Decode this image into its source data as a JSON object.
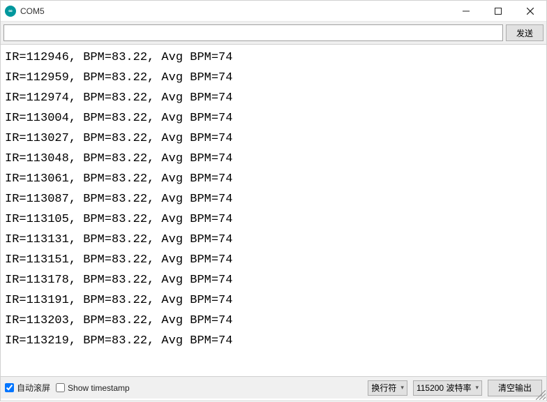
{
  "window": {
    "title": "COM5"
  },
  "toolbar": {
    "input_value": "",
    "send_label": "发送"
  },
  "output": {
    "lines": [
      "IR=112946, BPM=83.22, Avg BPM=74",
      "IR=112959, BPM=83.22, Avg BPM=74",
      "IR=112974, BPM=83.22, Avg BPM=74",
      "IR=113004, BPM=83.22, Avg BPM=74",
      "IR=113027, BPM=83.22, Avg BPM=74",
      "IR=113048, BPM=83.22, Avg BPM=74",
      "IR=113061, BPM=83.22, Avg BPM=74",
      "IR=113087, BPM=83.22, Avg BPM=74",
      "IR=113105, BPM=83.22, Avg BPM=74",
      "IR=113131, BPM=83.22, Avg BPM=74",
      "IR=113151, BPM=83.22, Avg BPM=74",
      "IR=113178, BPM=83.22, Avg BPM=74",
      "IR=113191, BPM=83.22, Avg BPM=74",
      "IR=113203, BPM=83.22, Avg BPM=74",
      "IR=113219, BPM=83.22, Avg BPM=74"
    ]
  },
  "status": {
    "autoscroll_label": "自动滚屏",
    "autoscroll_checked": true,
    "timestamp_label": "Show timestamp",
    "timestamp_checked": false,
    "line_ending_selected": "换行符",
    "baud_selected": "115200 波特率",
    "clear_label": "清空输出"
  }
}
